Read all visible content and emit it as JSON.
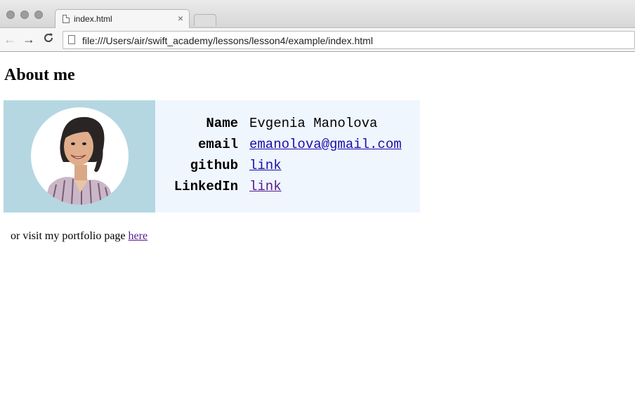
{
  "browser": {
    "tab_title": "index.html",
    "tab_close": "×",
    "url": "file:///Users/air/swift_academy/lessons/lesson4/example/index.html",
    "nav": {
      "back": "←",
      "forward": "→",
      "reload": "C"
    }
  },
  "page": {
    "heading": "About me",
    "profile": {
      "rows": [
        {
          "label": "Name",
          "value": "Evgenia Manolova"
        },
        {
          "label": "email",
          "value": "emanolova@gmail.com"
        },
        {
          "label": "github",
          "value": "link"
        },
        {
          "label": "LinkedIn",
          "value": "link"
        }
      ]
    },
    "footer": {
      "text": "or visit my portfolio page ",
      "link": "here"
    }
  },
  "colors": {
    "photo_background": "#b5d7e2",
    "card_background": "#eff6fe",
    "link": "#1a0dab",
    "visited_link": "#551a8b"
  }
}
